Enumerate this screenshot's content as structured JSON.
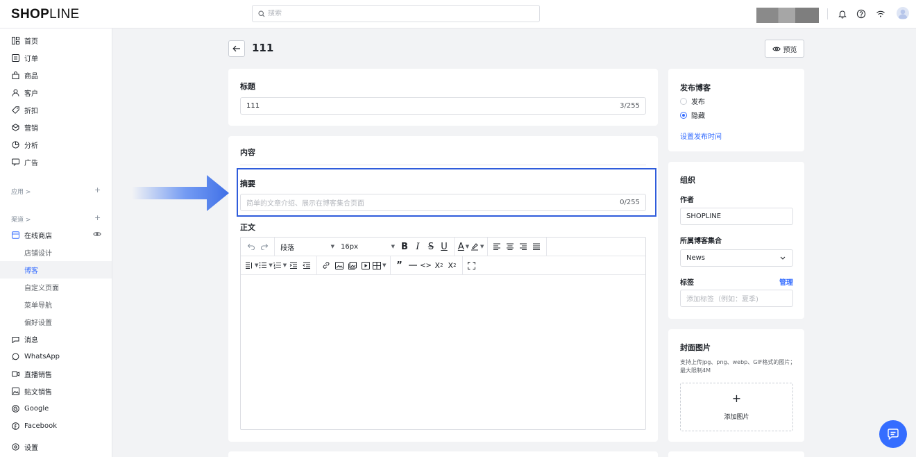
{
  "header": {
    "logo_bold": "SH",
    "logo_o": "O",
    "logo_bold2": "P",
    "logo_light": "LINE",
    "search_placeholder": "搜索"
  },
  "sidebar": {
    "items": [
      {
        "label": "首页",
        "icon": "home-icon"
      },
      {
        "label": "订单",
        "icon": "order-icon"
      },
      {
        "label": "商品",
        "icon": "product-icon"
      },
      {
        "label": "客户",
        "icon": "customer-icon"
      },
      {
        "label": "折扣",
        "icon": "tag-icon"
      },
      {
        "label": "营销",
        "icon": "marketing-icon"
      },
      {
        "label": "分析",
        "icon": "analytics-icon"
      },
      {
        "label": "广告",
        "icon": "ad-icon"
      }
    ],
    "apps_label": "应用 >",
    "channels_label": "渠道 >",
    "online_store": "在线商店",
    "online_store_sub": [
      "店铺设计",
      "博客",
      "自定义页面",
      "菜单导航",
      "偏好设置"
    ],
    "active_sub": "博客",
    "channels": [
      {
        "label": "消息",
        "icon": "message-icon"
      },
      {
        "label": "WhatsApp",
        "icon": "whatsapp-icon"
      },
      {
        "label": "直播销售",
        "icon": "live-icon"
      },
      {
        "label": "贴文销售",
        "icon": "post-icon"
      },
      {
        "label": "Google",
        "icon": "google-icon"
      },
      {
        "label": "Facebook",
        "icon": "facebook-icon"
      }
    ],
    "settings": "设置"
  },
  "page": {
    "title": "111",
    "preview": "预览"
  },
  "title_card": {
    "label": "标题",
    "value": "111",
    "count": "3/255"
  },
  "content_card": {
    "heading": "内容",
    "summary_label": "摘要",
    "summary_placeholder": "简单的文章介绍、展示在博客集合页面",
    "summary_count": "0/255",
    "body_label": "正文"
  },
  "editor": {
    "paragraph": "段落",
    "font_size": "16px"
  },
  "publish_card": {
    "title": "发布博客",
    "option_publish": "发布",
    "option_hide": "隐藏",
    "selected": "隐藏",
    "set_time": "设置发布时间"
  },
  "org_card": {
    "title": "组织",
    "author_label": "作者",
    "author_value": "SHOPLINE",
    "collection_label": "所属博客集合",
    "collection_value": "News",
    "tags_label": "标签",
    "tags_manage": "管理",
    "tags_placeholder": "添加标签（例如：夏季)"
  },
  "cover_card": {
    "title": "封面图片",
    "hint": "支持上传jpg、png、webp、GIF格式的图片；最大限制4M",
    "add": "添加图片"
  },
  "colors": {
    "accent": "#356dff",
    "highlight_border": "#2f5cdb",
    "arrow": "#4a7ef2"
  }
}
